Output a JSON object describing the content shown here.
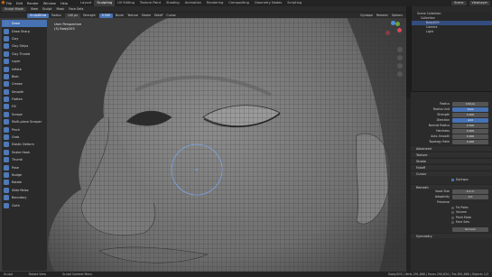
{
  "topbar": {
    "menus": [
      "File",
      "Edit",
      "Render",
      "Window",
      "Help"
    ],
    "tabs": [
      "Layout",
      "Sculpting",
      "UV Editing",
      "Texture Paint",
      "Shading",
      "Animation",
      "Rendering",
      "Compositing",
      "Geometry Nodes",
      "Scripting"
    ],
    "active_tab": "Sculpting",
    "scene": "Scene",
    "view_layer": "ViewLayer"
  },
  "header2": {
    "mode": "Sculpt Mode",
    "items": [
      "View",
      "Sculpt",
      "Mask",
      "Face Sets"
    ]
  },
  "tool_header": {
    "brush": "SculptDraw",
    "radius_label": "Radius",
    "radius_value": "140 px",
    "strength_label": "Strength",
    "strength_value": "0.500",
    "menus": [
      "Brush",
      "Texture",
      "Stroke",
      "Falloff",
      "Cursor"
    ],
    "right_menus": [
      "Dyntopo",
      "Remesh",
      "Options"
    ]
  },
  "viewport": {
    "perspective": "User Perspective",
    "object": "(3) BodyD03"
  },
  "toolbar": {
    "tools": [
      "Draw",
      "Draw Sharp",
      "Clay",
      "Clay Strips",
      "Clay Thumb",
      "Layer",
      "Inflate",
      "Blob",
      "Crease",
      "Smooth",
      "Flatten",
      "Fill",
      "Scrape",
      "Multi-plane Scraper",
      "Pinch",
      "Grab",
      "Elastic Deform",
      "Snake Hook",
      "Thumb",
      "Pose",
      "Nudge",
      "Rotate",
      "Slide Relax",
      "Boundary",
      "Cloth"
    ],
    "active": "Draw"
  },
  "outliner": {
    "title": "Scene Collection",
    "rows": [
      {
        "label": "Collection",
        "selected": false
      },
      {
        "label": "BodyD03",
        "selected": true
      },
      {
        "label": "Camera",
        "selected": false
      },
      {
        "label": "Light",
        "selected": false
      }
    ]
  },
  "properties": {
    "brush_rows": [
      {
        "label": "Radius",
        "value": "140 px"
      },
      {
        "label": "Radius Unit",
        "value": "View"
      },
      {
        "label": "Strength",
        "value": "0.500"
      },
      {
        "label": "Direction",
        "value": "Add"
      },
      {
        "label": "Normal Radius",
        "value": "0.500"
      },
      {
        "label": "Hardness",
        "value": "0.000"
      },
      {
        "label": "Auto-Smooth",
        "value": "0.000"
      },
      {
        "label": "Topology Rake",
        "value": "0.000"
      }
    ],
    "sections": [
      "Advanced",
      "Texture",
      "Stroke",
      "Falloff",
      "Cursor"
    ],
    "dyntopo": "Dyntopo",
    "remesh": "Remesh",
    "remesh_rows": [
      {
        "label": "Voxel Size",
        "value": "0.1 m"
      },
      {
        "label": "Adaptivity",
        "value": "0.0"
      }
    ],
    "preserve_label": "Preserve",
    "preserve_items": [
      "Fix Poles",
      "Volume",
      "Paint Mask",
      "Face Sets"
    ],
    "remesh_button": "Remesh",
    "symmetry": "Symmetry"
  },
  "statusbar": {
    "left": "Sculpt",
    "middle": "Rotate View",
    "right": "Sculpt Context Menu",
    "stats": "Body.D03 | Verts 291,868 | Faces 290,834 | Tris 581,668 | Objects 1/3"
  },
  "colors": {
    "accent": "#4772b3",
    "orange": "#e87d0d"
  }
}
